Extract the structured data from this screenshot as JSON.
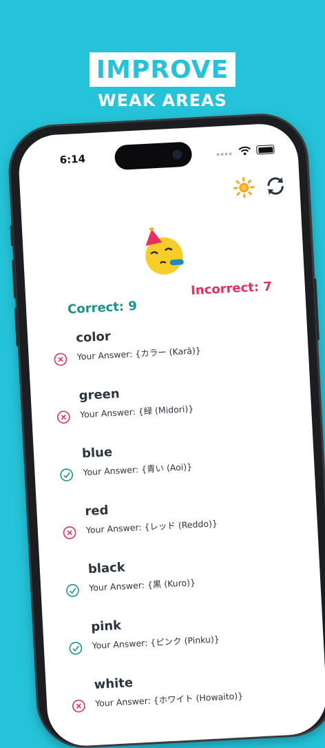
{
  "headline": {
    "top": "IMPROVE",
    "bottom": "WEAK AREAS"
  },
  "status_bar": {
    "time": "6:14"
  },
  "scores": {
    "correct": "Correct: 9",
    "incorrect": "Incorrect: 7"
  },
  "colors": {
    "background": "#25c3d9",
    "correct": "#17948a",
    "incorrect": "#e8305a",
    "sun": "#f2a81d"
  },
  "icons": {
    "settings": "sun-icon",
    "refresh": "refresh-icon",
    "wrong": "x-circle-icon",
    "right": "check-circle-icon",
    "emoji": "party-face-icon"
  },
  "results": [
    {
      "word": "color",
      "answer": "Your Answer: {カラー (Karā)}",
      "correct": false
    },
    {
      "word": "green",
      "answer": "Your Answer: {緑 (Midori)}",
      "correct": false
    },
    {
      "word": "blue",
      "answer": "Your Answer: {青い (Aoi)}",
      "correct": true
    },
    {
      "word": "red",
      "answer": "Your Answer: {レッド (Reddo)}",
      "correct": false
    },
    {
      "word": "black",
      "answer": "Your Answer: {黒 (Kuro)}",
      "correct": true
    },
    {
      "word": "pink",
      "answer": "Your Answer: {ピンク (Pinku)}",
      "correct": true
    },
    {
      "word": "white",
      "answer": "Your Answer: {ホワイト (Howaito)}",
      "correct": false
    }
  ]
}
